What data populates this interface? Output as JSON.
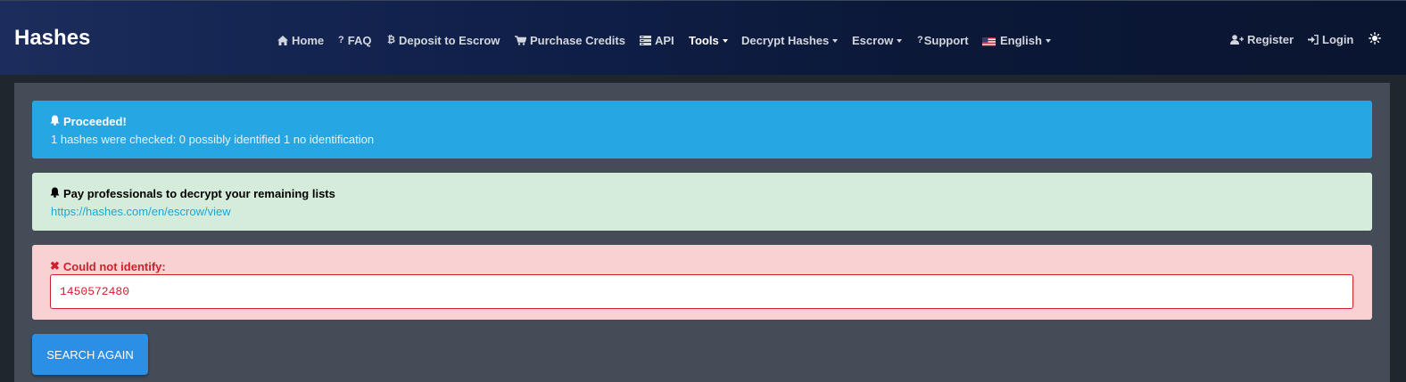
{
  "brand": "Hashes",
  "nav": {
    "home": "Home",
    "faq": "FAQ",
    "deposit": "Deposit to Escrow",
    "purchase": "Purchase Credits",
    "api": "API",
    "tools": "Tools",
    "decrypt": "Decrypt Hashes",
    "escrow": "Escrow",
    "support": "Support",
    "language": "English",
    "register": "Register",
    "login": "Login"
  },
  "alerts": {
    "info": {
      "title": "Proceeded!",
      "text": "1 hashes were checked: 0 possibly identified 1 no identification"
    },
    "success": {
      "title": "Pay professionals to decrypt your remaining lists",
      "link": "https://hashes.com/en/escrow/view"
    },
    "danger": {
      "title": "Could not identify:",
      "hash_value": "1450572480"
    }
  },
  "button": {
    "search_again": "SEARCH AGAIN"
  },
  "icons": {
    "home": "home-icon",
    "faq": "question-icon",
    "deposit": "bitcoin-icon",
    "purchase": "cart-icon",
    "api": "server-icon",
    "support": "question-icon",
    "language": "us-flag-icon",
    "register": "user-plus-icon",
    "login": "sign-in-icon",
    "theme": "sun-icon",
    "alert": "bell-icon",
    "error": "x-icon"
  },
  "colors": {
    "info": "#26a7e3",
    "success": "#d5ecdb",
    "danger": "#f9d1d3",
    "danger_text": "#d0202c",
    "button": "#2b8fe6",
    "panel": "#444c57"
  }
}
